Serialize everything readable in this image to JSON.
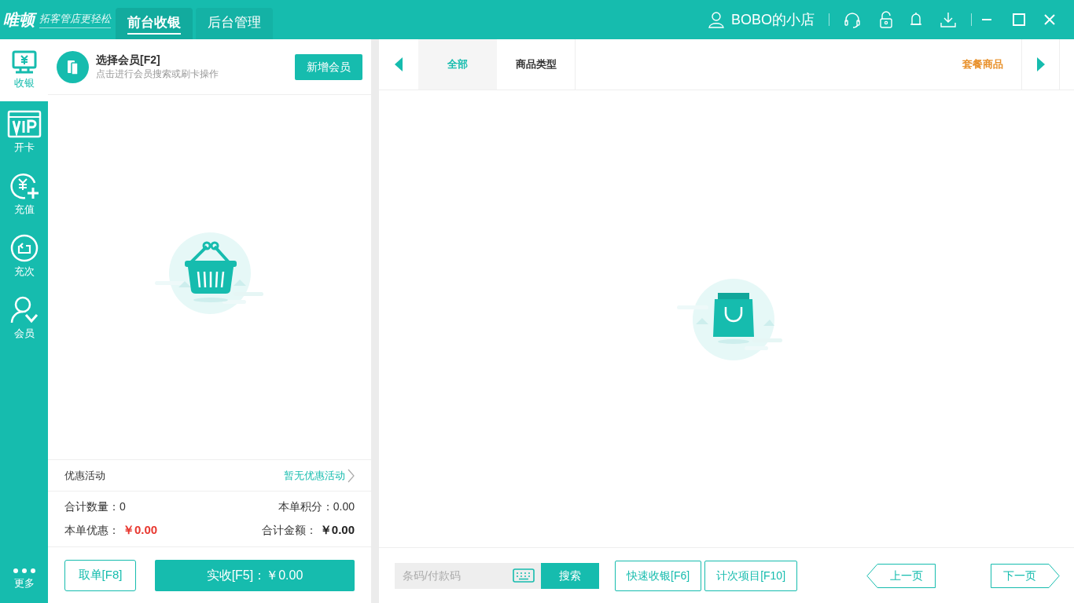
{
  "header": {
    "logo": "唯顿",
    "slogan": "拓客管店更轻松",
    "tabs": [
      {
        "label": "前台收银",
        "selected": true
      },
      {
        "label": "后台管理",
        "selected": false
      }
    ],
    "shop": "BOBO的小店"
  },
  "sidebar": {
    "items": [
      {
        "label": "收银",
        "kind": "cashier",
        "selected": true
      },
      {
        "label": "开卡",
        "kind": "vip",
        "selected": false
      },
      {
        "label": "充值",
        "kind": "recharge",
        "selected": false
      },
      {
        "label": "充次",
        "kind": "times",
        "selected": false
      },
      {
        "label": "会员",
        "kind": "member",
        "selected": false
      }
    ],
    "more": "更多"
  },
  "member": {
    "title": "选择会员[F2]",
    "hint": "点击进行会员搜索或刷卡操作",
    "add_button": "新增会员"
  },
  "promotion": {
    "label": "优惠活动",
    "value": "暂无优惠活动"
  },
  "totals": [
    {
      "label": "合计数量：",
      "value": "0",
      "kind": "plain"
    },
    {
      "label": "本单积分：",
      "value": "0.00",
      "kind": "plain"
    },
    {
      "label": "本单优惠：",
      "value": "￥0.00",
      "kind": "discount"
    },
    {
      "label": "合计金额：",
      "value": "￥0.00",
      "kind": "total"
    }
  ],
  "actions": {
    "cancel": "取单[F8]",
    "pay": "实收[F5]：￥0.00"
  },
  "categories": {
    "tabs": [
      {
        "label": "全部",
        "selected": true
      },
      {
        "label": "商品类型",
        "selected": false
      }
    ],
    "package_tab": "套餐商品"
  },
  "bottom": {
    "search_placeholder": "条码/付款码",
    "search_button": "搜索",
    "buttons": [
      "快速收银[F6]",
      "计次项目[F10]"
    ],
    "prev": "上一页",
    "next": "下一页"
  }
}
